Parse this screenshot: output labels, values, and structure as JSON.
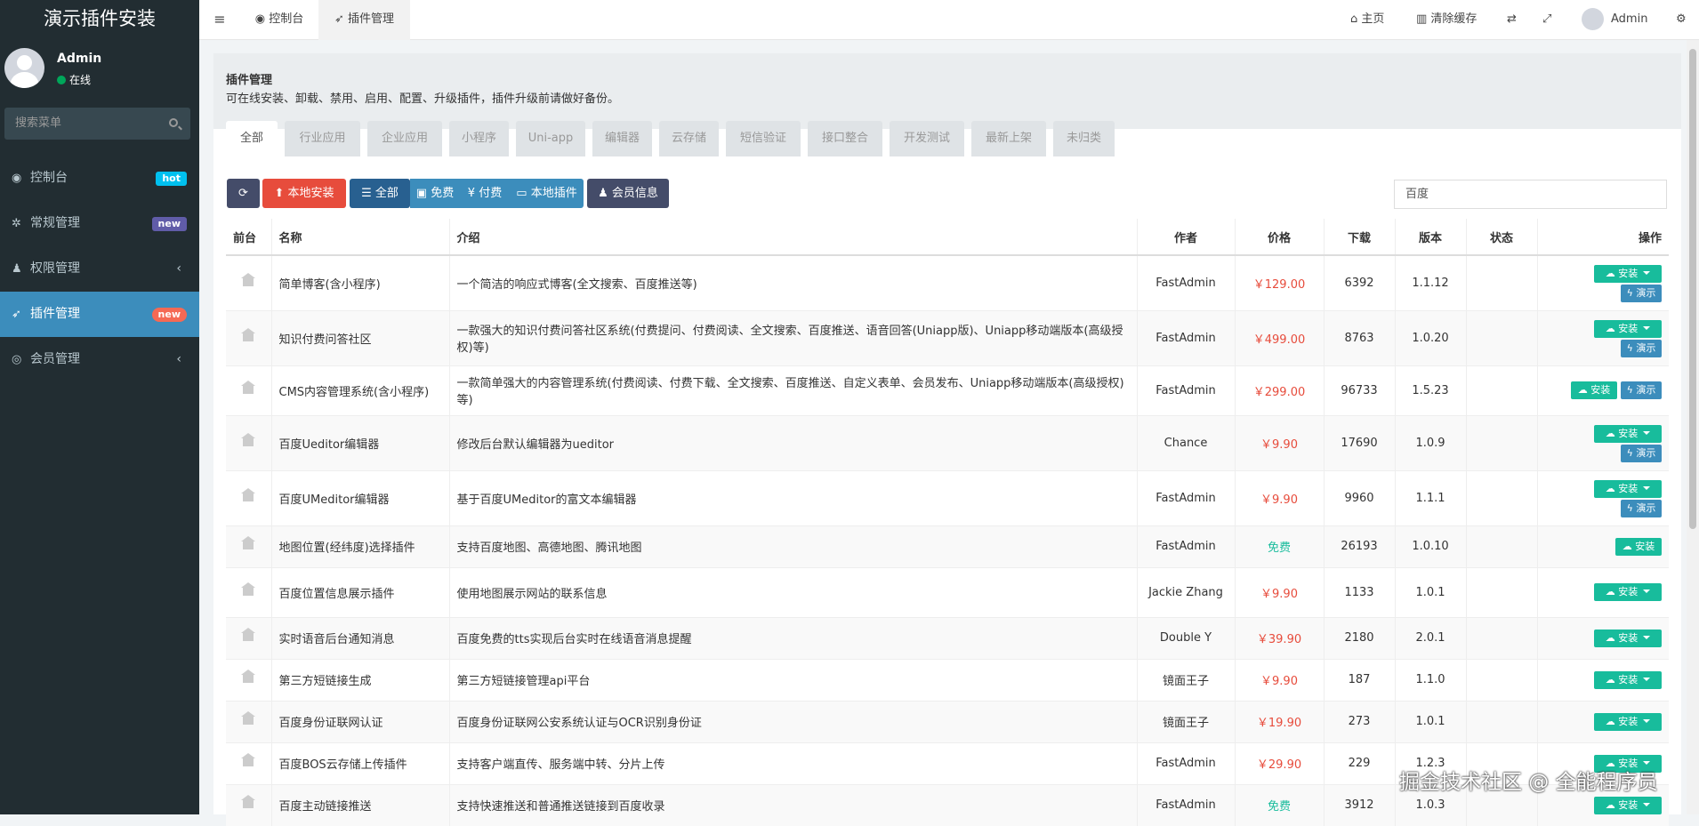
{
  "app": {
    "title": "演示插件安装"
  },
  "user": {
    "name": "Admin",
    "status": "在线"
  },
  "sidebar": {
    "search_placeholder": "搜索菜单",
    "items": [
      {
        "label": "控制台",
        "icon": "dashboard-icon",
        "badge": "hot"
      },
      {
        "label": "常规管理",
        "icon": "cogs-icon",
        "badge": "new"
      },
      {
        "label": "权限管理",
        "icon": "users-icon",
        "badge": ""
      },
      {
        "label": "插件管理",
        "icon": "rocket-icon",
        "badge": "new"
      },
      {
        "label": "会员管理",
        "icon": "user-circle-icon",
        "badge": ""
      }
    ]
  },
  "topbar": {
    "tabs": [
      {
        "label": "控制台"
      },
      {
        "label": "插件管理"
      }
    ],
    "home": "主页",
    "clear_cache": "清除缓存",
    "username": "Admin"
  },
  "header": {
    "title": "插件管理",
    "desc": "可在线安装、卸载、禁用、启用、配置、升级插件，插件升级前请做好备份。"
  },
  "categories": [
    "全部",
    "行业应用",
    "企业应用",
    "小程序",
    "Uni-app",
    "编辑器",
    "云存储",
    "短信验证",
    "接口整合",
    "开发测试",
    "最新上架",
    "未归类"
  ],
  "toolbar": {
    "local_install": "本地安装",
    "all": "全部",
    "free": "免费",
    "paid": "付费",
    "local_plugin": "本地插件",
    "member_info": "会员信息",
    "search_value": "百度"
  },
  "table": {
    "headers": [
      "前台",
      "名称",
      "介绍",
      "作者",
      "价格",
      "下载",
      "版本",
      "状态",
      "操作"
    ],
    "install_label": "安装",
    "demo_label": "演示",
    "rows": [
      {
        "name": "简单博客(含小程序)",
        "intro": "一个简洁的响应式博客(全文搜索、百度推送等)",
        "author": "FastAdmin",
        "price": "￥129.00",
        "downloads": "6392",
        "version": "1.1.12",
        "op": "dropdown-demo"
      },
      {
        "name": "知识付费问答社区",
        "intro": "一款强大的知识付费问答社区系统(付费提问、付费阅读、全文搜索、百度推送、语音回答(Uniapp版)、Uniapp移动端版本(高级授权)等)",
        "author": "FastAdmin",
        "price": "￥499.00",
        "downloads": "8763",
        "version": "1.0.20",
        "op": "dropdown-demo"
      },
      {
        "name": "CMS内容管理系统(含小程序)",
        "intro": "一款简单强大的内容管理系统(付费阅读、付费下载、全文搜索、百度推送、自定义表单、会员发布、Uniapp移动端版本(高级授权)等)",
        "author": "FastAdmin",
        "price": "￥299.00",
        "downloads": "96733",
        "version": "1.5.23",
        "op": "inline"
      },
      {
        "name": "百度Ueditor编辑器",
        "intro": "修改后台默认编辑器为ueditor",
        "author": "Chance",
        "price": "￥9.90",
        "downloads": "17690",
        "version": "1.0.9",
        "op": "dropdown-demo"
      },
      {
        "name": "百度UMeditor编辑器",
        "intro": "基于百度UMeditor的富文本编辑器",
        "author": "FastAdmin",
        "price": "￥9.90",
        "downloads": "9960",
        "version": "1.1.1",
        "op": "dropdown-demo"
      },
      {
        "name": "地图位置(经纬度)选择插件",
        "intro": "支持百度地图、高德地图、腾讯地图",
        "author": "FastAdmin",
        "price": "免费",
        "downloads": "26193",
        "version": "1.0.10",
        "op": "plain"
      },
      {
        "name": "百度位置信息展示插件",
        "intro": "使用地图展示网站的联系信息",
        "author": "Jackie Zhang",
        "price": "￥9.90",
        "downloads": "1133",
        "version": "1.0.1",
        "op": "dropdown"
      },
      {
        "name": "实时语音后台通知消息",
        "intro": "百度免费的tts实现后台实时在线语音消息提醒",
        "author": "Double Y",
        "price": "￥39.90",
        "downloads": "2180",
        "version": "2.0.1",
        "op": "dropdown"
      },
      {
        "name": "第三方短链接生成",
        "intro": "第三方短链接管理api平台",
        "author": "镜面王子",
        "price": "￥9.90",
        "downloads": "187",
        "version": "1.1.0",
        "op": "dropdown"
      },
      {
        "name": "百度身份证联网认证",
        "intro": "百度身份证联网公安系统认证与OCR识别身份证",
        "author": "镜面王子",
        "price": "￥19.90",
        "downloads": "273",
        "version": "1.0.1",
        "op": "dropdown"
      },
      {
        "name": "百度BOS云存储上传插件",
        "intro": "支持客户端直传、服务端中转、分片上传",
        "author": "FastAdmin",
        "price": "￥29.90",
        "downloads": "229",
        "version": "1.2.3",
        "op": "dropdown"
      },
      {
        "name": "百度主动链接推送",
        "intro": "支持快速推送和普通推送链接到百度收录",
        "author": "FastAdmin",
        "price": "免费",
        "downloads": "3912",
        "version": "1.0.3",
        "op": "dropdown"
      }
    ]
  },
  "watermark": "掘金技术社区 @ 全能程序员"
}
